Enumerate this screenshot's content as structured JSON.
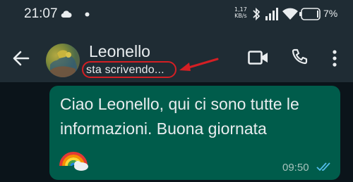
{
  "statusbar": {
    "time": "21:07",
    "net_speed_value": "1,17",
    "net_speed_unit": "KB/s",
    "battery_percent": "7%"
  },
  "header": {
    "contact_name": "Leonello",
    "contact_status": "sta scrivendo...",
    "icons": [
      "back-arrow-icon",
      "video-call-icon",
      "voice-call-icon",
      "more-options-icon"
    ]
  },
  "message": {
    "text": "Ciao Leonello, qui ci sono tutte le informazioni. Buona giornata",
    "emoji": "rainbow-icon",
    "time": "09:50",
    "read_status": "double-check-icon"
  },
  "colors": {
    "accent_annotation": "#d41f24",
    "bubble": "#005c4b",
    "header_bg": "#1f2c34",
    "chat_bg": "#0b141a",
    "read_ticks": "#53bdeb"
  }
}
